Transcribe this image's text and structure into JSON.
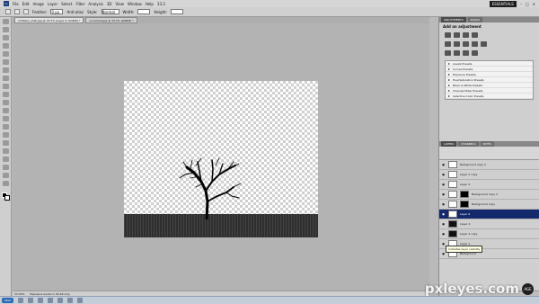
{
  "app": {
    "logo": "Ps",
    "workspace": "ESSENTIALS",
    "zoom": "33.3"
  },
  "menu": [
    "File",
    "Edit",
    "Image",
    "Layer",
    "Select",
    "Filter",
    "Analysis",
    "3D",
    "View",
    "Window",
    "Help"
  ],
  "options": {
    "feather_label": "Feather:",
    "feather_value": "0 px",
    "antialias_label": "Anti-alias",
    "style_label": "Style:",
    "style_value": "Normal",
    "width_label": "Width:",
    "height_label": "Height:"
  },
  "doc_tabs": [
    {
      "label": "1299sky_shell.jpg @ 33.3% (Layer 6, RGB/8) *",
      "active": true
    },
    {
      "label": "unnamed.jpg @ 33.3% (RGB/8) *",
      "active": false
    }
  ],
  "status": {
    "zoom": "33.33%",
    "info": "Exposure works in 32-bit only"
  },
  "panels": {
    "top_tabs": [
      "ADJUSTMENTS",
      "MASKS"
    ],
    "adjustments_title": "Add an adjustment",
    "presets": [
      "Levels Presets",
      "Curves Presets",
      "Exposure Presets",
      "Hue/Saturation Presets",
      "Black & White Presets",
      "Channel Mixer Presets",
      "Selective Color Presets"
    ],
    "layer_tabs": [
      "LAYERS",
      "CHANNELS",
      "PATHS"
    ]
  },
  "layers": [
    {
      "name": "Background copy 2",
      "thumb": "light",
      "selected": false,
      "mask": false
    },
    {
      "name": "Layer 2 copy",
      "thumb": "light",
      "selected": false,
      "mask": false
    },
    {
      "name": "Layer 2",
      "thumb": "light",
      "selected": false,
      "mask": false
    },
    {
      "name": "Background copy 3",
      "thumb": "light",
      "selected": false,
      "mask": true
    },
    {
      "name": "Background copy",
      "thumb": "light",
      "selected": false,
      "mask": true
    },
    {
      "name": "Layer 6",
      "thumb": "light",
      "selected": true,
      "mask": false
    },
    {
      "name": "Layer 4",
      "thumb": "dark",
      "selected": false,
      "mask": false
    },
    {
      "name": "Layer 3 copy",
      "thumb": "dark",
      "selected": false,
      "mask": false
    },
    {
      "name": "Layer 1",
      "thumb": "light",
      "selected": false,
      "mask": false
    },
    {
      "name": "Background",
      "thumb": "light",
      "selected": false,
      "mask": false
    }
  ],
  "tooltip": "Indicates layer visibility",
  "taskbar": {
    "start_label": "Start"
  },
  "watermark": {
    "text": "pxleyes.com",
    "badge": "AGE"
  }
}
